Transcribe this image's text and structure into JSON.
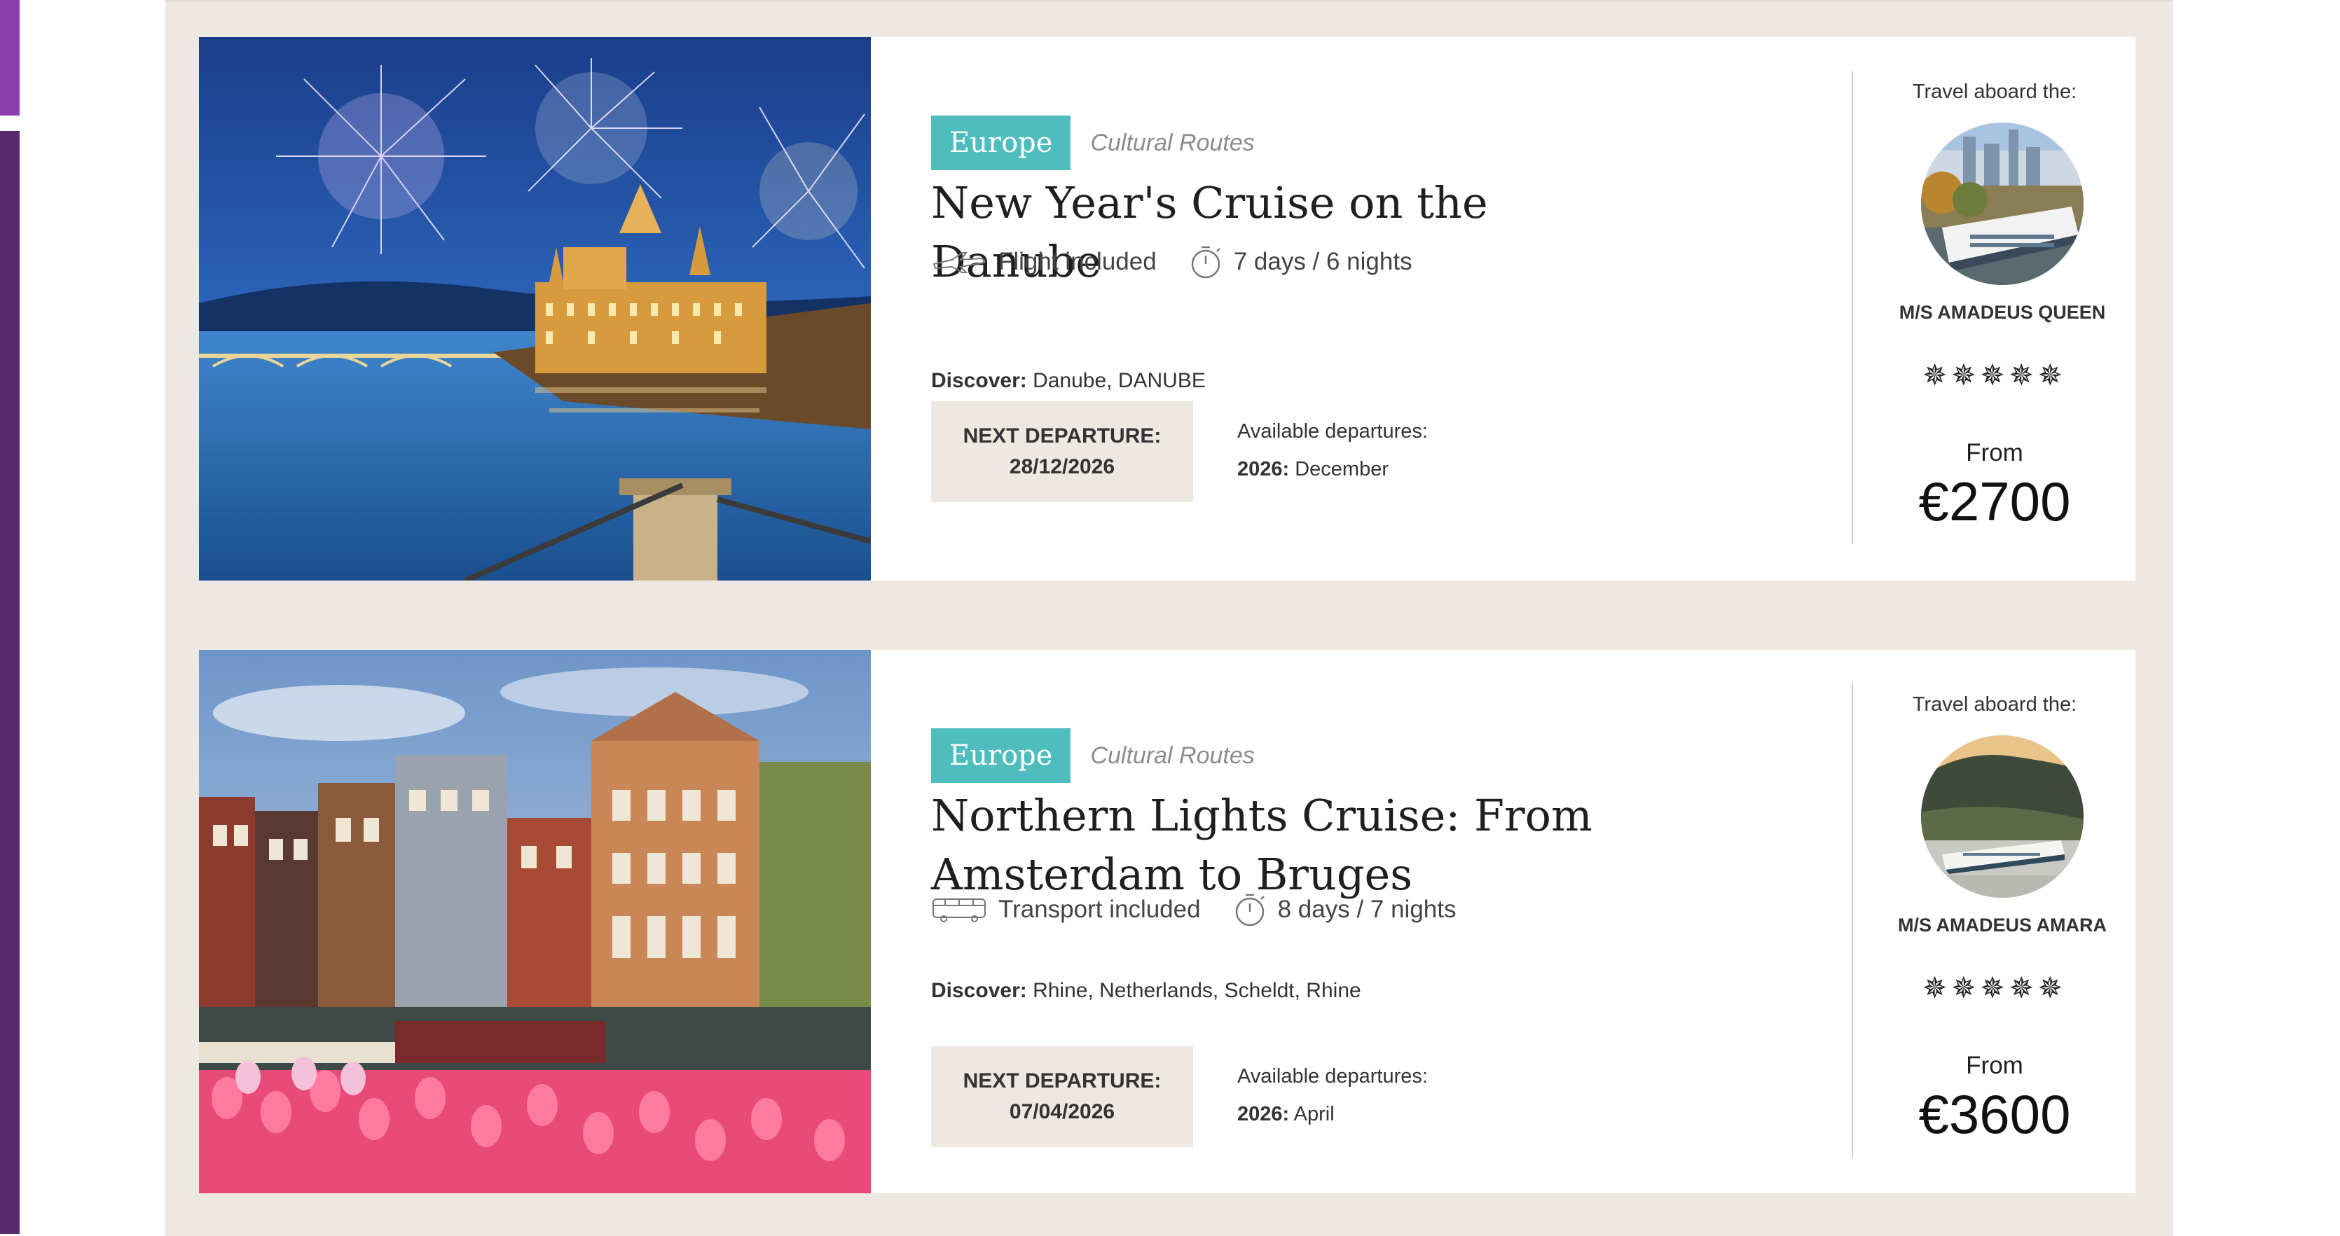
{
  "cruises": [
    {
      "image_alt": "Budapest parliament with fireworks",
      "region": "Europe",
      "category": "Cultural Routes",
      "title": "New Year's Cruise on the Danube",
      "transport": "Flight included",
      "transport_icon": "plane-icon",
      "duration": "7 days / 6 nights",
      "discover_label": "Discover:",
      "discover_value": "Danube, DANUBE",
      "next_departure_label": "NEXT DEPARTURE:",
      "next_departure_date": "28/12/2026",
      "available_label": "Available departures:",
      "available_year": "2026:",
      "available_months": "December",
      "aboard_label": "Travel aboard the:",
      "ship_name": "M/S AMADEUS QUEEN",
      "stars": "✵✵✵✵✵",
      "star_count": 5,
      "from_label": "From",
      "price": "€2700"
    },
    {
      "image_alt": "Amsterdam canal houses with tulips",
      "region": "Europe",
      "category": "Cultural Routes",
      "title": "Northern Lights Cruise: From Amsterdam to Bruges",
      "transport": "Transport included",
      "transport_icon": "bus-icon",
      "duration": "8 days / 7 nights",
      "discover_label": "Discover:",
      "discover_value": "Rhine, Netherlands, Scheldt, Rhine",
      "next_departure_label": "NEXT DEPARTURE:",
      "next_departure_date": "07/04/2026",
      "available_label": "Available departures:",
      "available_year": "2026:",
      "available_months": "April",
      "aboard_label": "Travel aboard the:",
      "ship_name": "M/S AMADEUS AMARA",
      "stars": "✵✵✵✵✵",
      "star_count": 5,
      "from_label": "From",
      "price": "€3600"
    }
  ],
  "colors": {
    "region_tag": "#4fbdbd",
    "page_bg": "#ede8e2",
    "accent_purple": "#8a3fb0"
  }
}
